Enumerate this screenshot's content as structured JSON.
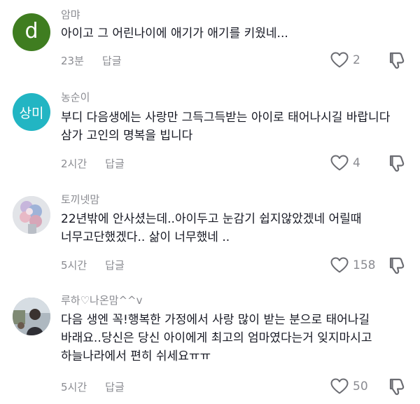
{
  "comments": [
    {
      "avatar": {
        "type": "letter",
        "text": "d",
        "bg": "#3f7d20"
      },
      "username": "암먀",
      "lines": [
        "아이고 그 어린나이에 애기가 애기를 키웠네..."
      ],
      "time": "23분",
      "reply_label": "답글",
      "likes": "2"
    },
    {
      "avatar": {
        "type": "letter",
        "text": "상미",
        "bg": "#22b5c3"
      },
      "username": "농순이",
      "lines": [
        "부디 다음생에는 사랑만 그득그득받는 아이로 태어나시길 바랍니다",
        "삼가 고인의 명복을 빕니다"
      ],
      "time": "2시간",
      "reply_label": "답글",
      "likes": "4"
    },
    {
      "avatar": {
        "type": "photo",
        "desc": "flowers"
      },
      "username": "토끼넷맘",
      "lines": [
        "22년밖에 안사셨는데..아이두고 눈감기 쉽지않았겠네 어릴때",
        "너무고단했겠다.. 삶이 너무했네 .."
      ],
      "time": "5시간",
      "reply_label": "답글",
      "likes": "158"
    },
    {
      "avatar": {
        "type": "photo",
        "desc": "person"
      },
      "username": "루하♡나온맘^^v",
      "lines": [
        "다음 생엔 꼭!행복한 가정에서 사랑 많이 받는 분으로 태어나길",
        "바래요..당신은 당신 아이에게 최고의 엄마였다는거 잊지마시고",
        "하늘나라에서 편히 쉬세요ㅠㅠ"
      ],
      "time": "5시간",
      "reply_label": "답글",
      "likes": "50"
    }
  ],
  "colors": {
    "text": "#161823",
    "muted": "#8a8b91",
    "icon": "#6b6c72"
  },
  "icons": {
    "like": "heart-outline-icon",
    "dislike": "thumbs-down-outline-icon"
  }
}
